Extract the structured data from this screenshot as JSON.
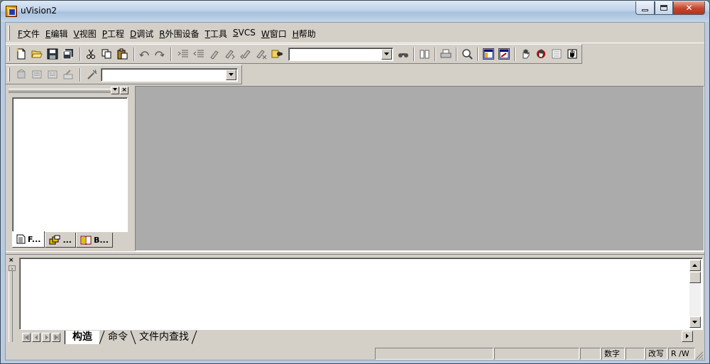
{
  "window": {
    "title": "uVision2"
  },
  "menu": [
    {
      "key": "F",
      "label": "文件"
    },
    {
      "key": "E",
      "label": "编辑"
    },
    {
      "key": "V",
      "label": "视图"
    },
    {
      "key": "P",
      "label": "工程"
    },
    {
      "key": "D",
      "label": "调试"
    },
    {
      "key": "R",
      "label": "外围设备"
    },
    {
      "key": "T",
      "label": "工具"
    },
    {
      "key": "S",
      "label": "VCS"
    },
    {
      "key": "W",
      "label": "窗口"
    },
    {
      "key": "H",
      "label": "帮助"
    }
  ],
  "toolbar1": {
    "find_combo_value": "",
    "icons": [
      "new-file-icon",
      "open-folder-icon",
      "save-icon",
      "save-all-icon",
      "cut-icon",
      "copy-icon",
      "paste-icon",
      "undo-icon",
      "redo-icon",
      "indent-icon",
      "unindent-icon",
      "bookmark-toggle-icon",
      "bookmark-next-icon",
      "bookmark-prev-icon",
      "bookmark-clear-icon",
      "find-in-files-icon",
      "find-icon",
      "bookmark-book-icon",
      "print-icon",
      "zoom-icon",
      "workspace-window-icon",
      "output-window-icon",
      "debug-hand-icon",
      "breakpoint-icon",
      "clear-breakpoints-icon",
      "stop-icon"
    ]
  },
  "toolbar2": {
    "target_combo_value": "",
    "icons": [
      "translate-icon",
      "build-icon",
      "rebuild-icon",
      "stop-build-icon",
      "options-icon"
    ]
  },
  "workspace": {
    "tabs": [
      {
        "label": "F...",
        "icon": "files-tab-icon"
      },
      {
        "label": "...",
        "icon": "registers-tab-icon"
      },
      {
        "label": "B...",
        "icon": "books-tab-icon"
      }
    ]
  },
  "output": {
    "tabs": [
      "构造",
      "命令",
      "文件内查找"
    ],
    "active_tab": "构造"
  },
  "statusbar": {
    "num": "数字",
    "ovr": "改写",
    "rw": "R /W"
  },
  "colors": {
    "face": "#d4d0c8",
    "mdi_background": "#ababab",
    "window_frame": "#b9cbe0"
  }
}
